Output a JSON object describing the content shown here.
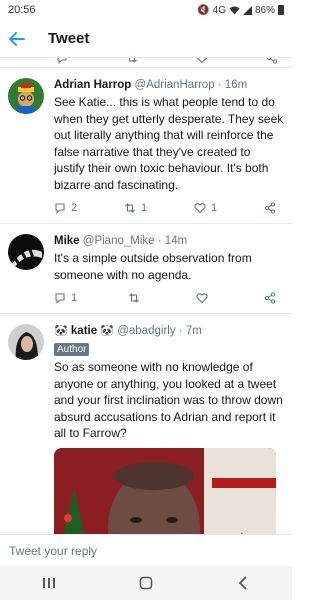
{
  "status_bar": {
    "time": "20:56",
    "network": "4G",
    "battery": "86%"
  },
  "header": {
    "title": "Tweet"
  },
  "tweets": [
    {
      "name": "Adrian Harrop",
      "handle": "@AdrianHarrop",
      "time": "16m",
      "text": "See Katie... this is what people tend to do when they get utterly desperate. They seek out literally anything that will reinforce the false narrative that they've created to justify their own toxic behaviour. It's both bizarre and fascinating.",
      "replies": "2",
      "retweets": "1",
      "likes": "1"
    },
    {
      "name": "Mike",
      "handle": "@Piano_Mike",
      "time": "14m",
      "text": "It's a simple outside observation from someone with no agenda.",
      "replies": "1",
      "retweets": "",
      "likes": ""
    },
    {
      "name": "katie",
      "name_prefix_emoji": "🐼",
      "name_suffix_emoji": "🐼",
      "handle": "@abadgirly",
      "time": "7m",
      "badge": "Author",
      "text": "So as someone with no knowledge of anyone or anything, you looked at a tweet and your first inclination was to throw down absurd accusations to Adrian and report  it all to Farrow?",
      "media_text": "nost"
    }
  ],
  "reply_bar": {
    "placeholder": "Tweet your reply"
  },
  "colors": {
    "accent": "#1da1f2",
    "secondary_text": "#657786",
    "divider": "#e1e8ed"
  },
  "icons": [
    "back-arrow-icon",
    "reply-icon",
    "retweet-icon",
    "like-icon",
    "share-icon",
    "recent-apps-icon",
    "home-icon",
    "back-icon"
  ]
}
